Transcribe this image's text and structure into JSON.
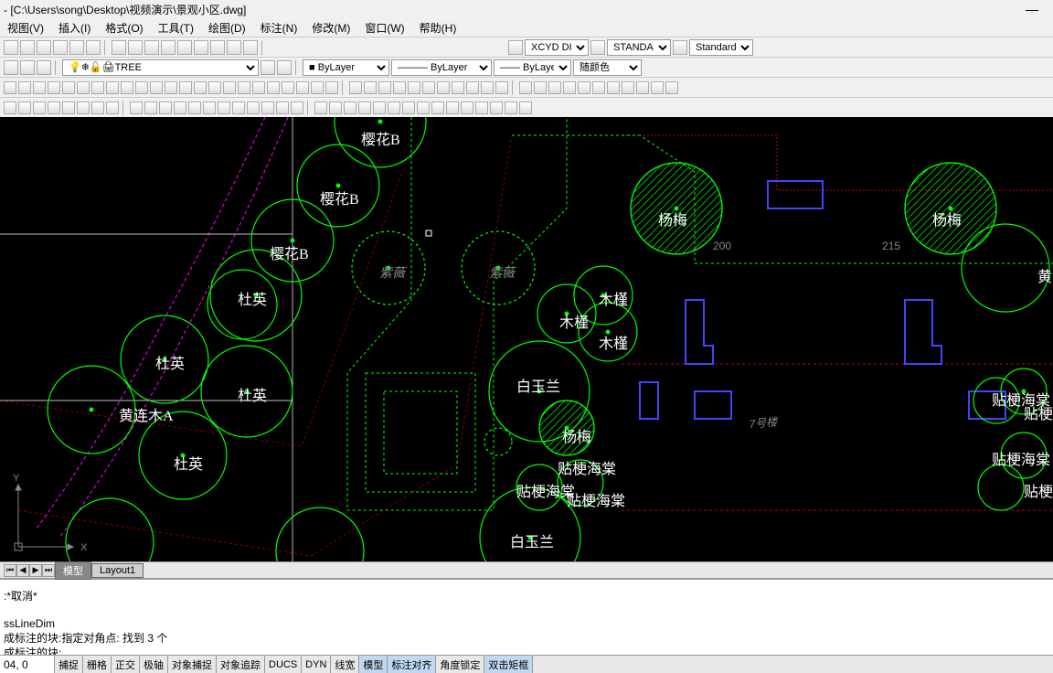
{
  "title": "- [C:\\Users\\song\\Desktop\\视频演示\\景观小区.dwg]",
  "menu": {
    "view": "视图(V)",
    "insert": "插入(I)",
    "format": "格式(O)",
    "tools": "工具(T)",
    "draw": "绘图(D)",
    "dim": "标注(N)",
    "modify": "修改(M)",
    "window": "窗口(W)",
    "help": "帮助(H)"
  },
  "style_selects": {
    "dimstyle": "XCYD DIM",
    "textstyle": "STANDARD",
    "tablestyle": "Standard"
  },
  "layer": {
    "current": "TREE",
    "color_by": "ByLayer",
    "line_by": "ByLayer",
    "lw_by": "ByLayer",
    "plot": "随颜色"
  },
  "tabs": {
    "model": "模型",
    "layout1": "Layout1"
  },
  "cmd": {
    "l1": ":*取消*",
    "l2": "ssLineDim",
    "l3": "成标注的块:指定对角点: 找到 3 个",
    "l4": "成标注的块:"
  },
  "status": {
    "coord": "04, 0",
    "snap": "捕捉",
    "grid": "栅格",
    "ortho": "正交",
    "polar": "极轴",
    "osnap": "对象捕捉",
    "otrack": "对象追踪",
    "ducs": "DUCS",
    "dyn": "DYN",
    "lw": "线宽",
    "model": "模型",
    "annot": "标注对齐",
    "angle": "角度锁定",
    "dbl": "双击矩框"
  },
  "trees": {
    "yinghua_b_1": "樱花B",
    "yinghua_b_2": "樱花B",
    "yinghua_b_3": "樱花B",
    "duying_1": "杜英",
    "duying_2": "杜英",
    "duying_3": "杜英",
    "duying_4": "杜英",
    "huanglian": "黄连木A",
    "yangmei_1": "杨梅",
    "yangmei_2": "杨梅",
    "yangmei_3": "杨梅",
    "mujin_1": "木槿",
    "mujin_2": "木槿",
    "mujin_3": "木槿",
    "baiyulan_1": "白玉兰",
    "baiyulan_2": "白玉兰",
    "tiegehaitang_1": "贴梗海棠",
    "tiegehaitang_2": "贴梗海棠",
    "tiegehaitang_3": "贴梗海棠",
    "tiegehaitang_4": "贴梗海棠",
    "tiegehaitang_5": "贴梗海棠",
    "tiegehaitang_6": "贴梗海棠",
    "tiegehaitang_7": "贴梗海棠",
    "ziwei_1": "紫薇",
    "ziwei_2": "紫薇",
    "huang": "黄",
    "building": "7号楼",
    "scale_marks": [
      "200",
      "215"
    ],
    "axis_x": "X",
    "axis_y": "Y"
  }
}
